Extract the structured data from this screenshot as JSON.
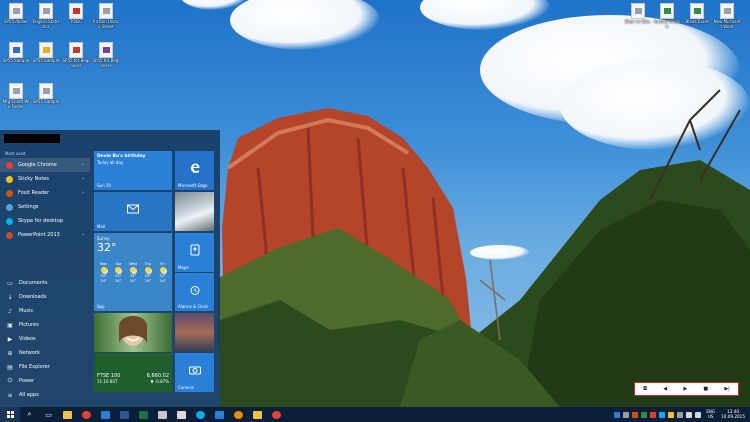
{
  "desktop": {
    "icons_left": [
      {
        "label": "SP55 dealer",
        "color": "gray"
      },
      {
        "label": "English Statistics",
        "color": "gray"
      },
      {
        "label": "TOEIC",
        "color": "red"
      },
      {
        "label": "fuction Unlock Sheet",
        "color": "gray"
      },
      {
        "label": "SP55 Sample",
        "color": "blue"
      },
      {
        "label": "SP55 Sample",
        "color": "yellow"
      },
      {
        "label": "SP55 for Beginners",
        "color": "red"
      },
      {
        "label": "SP55 for Beginners",
        "color": "purple"
      },
      {
        "label": "Mtg Client Win Folder",
        "color": "gray"
      },
      {
        "label": "SP55 Sample",
        "color": "gray"
      }
    ],
    "icons_right": [
      {
        "label": "Dear sir Doc.",
        "color": "gray"
      },
      {
        "label": "fuction Unlock",
        "color": "green"
      },
      {
        "label": "Blank Excel",
        "color": "green"
      },
      {
        "label": "New Microsoft Word",
        "color": "gray"
      }
    ]
  },
  "start_menu": {
    "most_used_heading": "Most used",
    "most_used": [
      {
        "label": "Google Chrome",
        "color": "#e34133",
        "has_arrow": true
      },
      {
        "label": "Sticky Notes",
        "color": "#f5c623",
        "has_arrow": true
      },
      {
        "label": "Foxit Reader",
        "color": "#d35400",
        "has_arrow": true
      },
      {
        "label": "Settings",
        "color": "#5aa0e0",
        "has_arrow": false
      },
      {
        "label": "Skype for desktop",
        "color": "#00aff0",
        "has_arrow": false
      },
      {
        "label": "PowerPoint 2013",
        "color": "#d24726",
        "has_arrow": true
      }
    ],
    "places": [
      {
        "label": "Documents",
        "glyph": "▭"
      },
      {
        "label": "Downloads",
        "glyph": "↓"
      },
      {
        "label": "Music",
        "glyph": "♪"
      },
      {
        "label": "Pictures",
        "glyph": "▣"
      },
      {
        "label": "Videos",
        "glyph": "▶"
      },
      {
        "label": "Network",
        "glyph": "⊕"
      },
      {
        "label": "File Explorer",
        "glyph": "▤"
      },
      {
        "label": "Power",
        "glyph": "⏻"
      },
      {
        "label": "All apps",
        "glyph": "≡"
      }
    ],
    "tiles": {
      "calendar": {
        "title": "Devie Bu's birthday",
        "subtitle": "Today all day",
        "label": "Sun 10"
      },
      "edge": {
        "label": "Microsoft Edge",
        "icon": "edge-icon"
      },
      "mail": {
        "label": "Mail",
        "icon": "mail-icon"
      },
      "weather": {
        "city": "Sunny",
        "temp": "32°",
        "label": "Sep",
        "days": [
          {
            "name": "Mon",
            "hi": "33°",
            "lo": "24°"
          },
          {
            "name": "Tue",
            "hi": "33°",
            "lo": "24°"
          },
          {
            "name": "Wed",
            "hi": "33°",
            "lo": "24°"
          },
          {
            "name": "Thu",
            "hi": "33°",
            "lo": "24°"
          },
          {
            "name": "Fri",
            "hi": "33°",
            "lo": "24°"
          }
        ]
      },
      "maps": {
        "label": "Maps",
        "icon": "map-pin-icon"
      },
      "alarms": {
        "label": "Alarms & Clock",
        "icon": "alarm-clock-icon"
      },
      "money": {
        "index": "FTSE 100",
        "time": "11:10 BST",
        "value": "6,660.02",
        "change": "▼ -0.87%"
      },
      "camera": {
        "label": "Camera",
        "icon": "camera-icon"
      }
    }
  },
  "media_bar": {
    "buttons": [
      "◘",
      "◀",
      "▶",
      "■",
      "▶|"
    ]
  },
  "taskbar": {
    "pinned": [
      {
        "name": "search",
        "glyph": "⌕",
        "color": "#ffffff"
      },
      {
        "name": "task-view",
        "glyph": "▭",
        "color": "#ffffff"
      },
      {
        "name": "file-explorer",
        "glyph": "",
        "color": "#f0c24b"
      },
      {
        "name": "chrome",
        "glyph": "",
        "color": "#e34133"
      },
      {
        "name": "edge",
        "glyph": "",
        "color": "#2a7fd6"
      },
      {
        "name": "word",
        "glyph": "",
        "color": "#2b5797"
      },
      {
        "name": "excel",
        "glyph": "",
        "color": "#1e7145"
      },
      {
        "name": "media-player",
        "glyph": "",
        "color": "#c8c8c8"
      },
      {
        "name": "calculator",
        "glyph": "",
        "color": "#d9d9d9"
      },
      {
        "name": "skype",
        "glyph": "",
        "color": "#00aff0"
      },
      {
        "name": "movies",
        "glyph": "",
        "color": "#2a7fd6"
      },
      {
        "name": "vlc",
        "glyph": "",
        "color": "#f28c00"
      },
      {
        "name": "folder",
        "glyph": "",
        "color": "#f0c24b"
      },
      {
        "name": "chrome-2",
        "glyph": "",
        "color": "#e34133"
      }
    ],
    "tray_colors": [
      "#2a7fd6",
      "#9aa0a6",
      "#d35400",
      "#2f8f46",
      "#e34133",
      "#00aff0",
      "#f5c623",
      "#9aa0a6",
      "#d9d9d9",
      "#d9d9d9"
    ],
    "language": "ENG",
    "region": "US",
    "time": "13:40",
    "date": "10.09.2015"
  }
}
